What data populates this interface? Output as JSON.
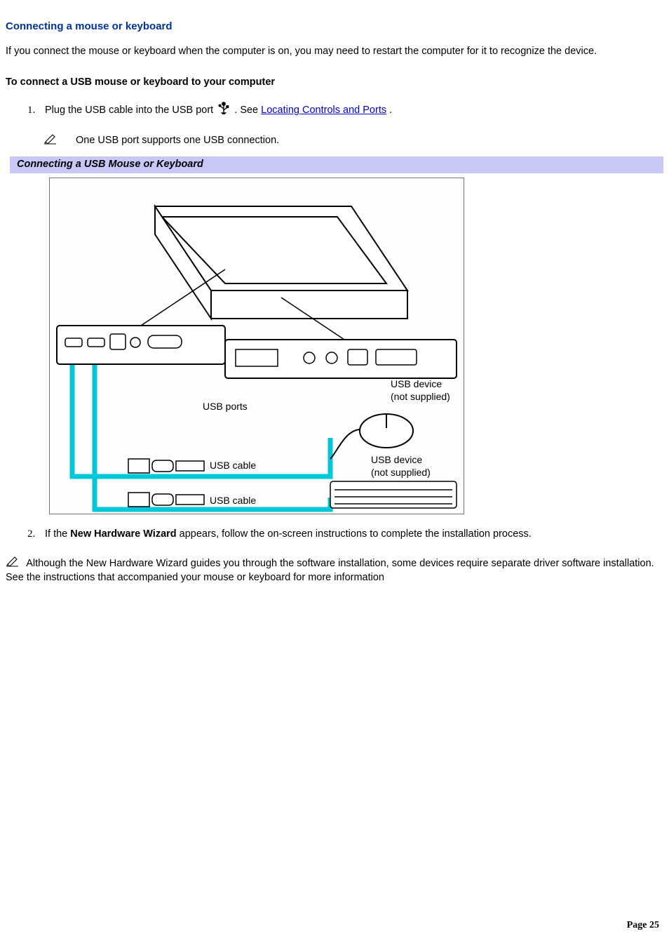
{
  "heading": "Connecting a mouse or keyboard",
  "intro": "If you connect the mouse or keyboard when the computer is on, you may need to restart the computer for it to recognize the device.",
  "subhead": "To connect a USB mouse or keyboard to your computer",
  "step1": {
    "prefix": "Plug the USB cable into the USB port ",
    "suffix_before_link": ". See ",
    "link_text": "Locating Controls and Ports",
    "suffix_after_link": "."
  },
  "note1": "One USB port supports one USB connection.",
  "banner": "Connecting a USB Mouse or Keyboard",
  "figure": {
    "usb_ports": "USB ports",
    "usb_cable_1": "USB cable",
    "usb_cable_2": "USB cable",
    "device_mouse_line1": "USB device",
    "device_mouse_line2": "(not supplied)",
    "device_kb_line1": "USB device",
    "device_kb_line2": "(not supplied)"
  },
  "step2": {
    "prefix": "If the ",
    "bold": "New Hardware Wizard",
    "suffix": " appears, follow the on-screen instructions to complete the installation process."
  },
  "final_note": "Although the New Hardware Wizard guides you through the software installation, some devices require separate driver software installation. See the instructions that accompanied your mouse or keyboard for more information",
  "page_footer": "Page 25"
}
